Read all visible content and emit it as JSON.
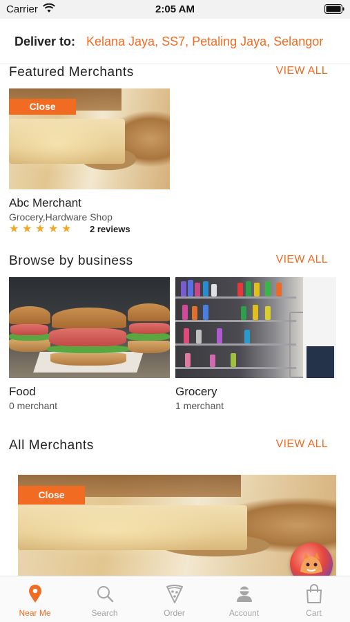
{
  "status_bar": {
    "carrier": "Carrier",
    "time": "2:05 AM"
  },
  "deliver": {
    "label": "Deliver to:",
    "address": "Kelana Jaya, SS7, Petaling Jaya, Selangor"
  },
  "featured": {
    "title": "Featured Merchants",
    "view_all": "VIEW ALL",
    "merchant": {
      "badge": "Close",
      "name": "Abc Merchant",
      "categories": "Grocery,Hardware Shop",
      "rating": 5,
      "reviews": "2 reviews"
    }
  },
  "browse": {
    "title": "Browse by business",
    "view_all": "VIEW ALL",
    "items": [
      {
        "name": "Food",
        "count": "0 merchant"
      },
      {
        "name": "Grocery",
        "count": "1 merchant"
      }
    ]
  },
  "all_merchants": {
    "title": "All Merchants",
    "view_all": "VIEW ALL",
    "badge": "Close"
  },
  "tabs": [
    {
      "label": "Near Me",
      "icon": "location-pin-icon",
      "active": true
    },
    {
      "label": "Search",
      "icon": "search-icon",
      "active": false
    },
    {
      "label": "Order",
      "icon": "pizza-icon",
      "active": false
    },
    {
      "label": "Account",
      "icon": "user-icon",
      "active": false
    },
    {
      "label": "Cart",
      "icon": "shopping-bag-icon",
      "active": false
    }
  ],
  "colors": {
    "accent": "#f26b22",
    "star": "#f5a623",
    "tab_inactive": "#a5a5a5"
  }
}
